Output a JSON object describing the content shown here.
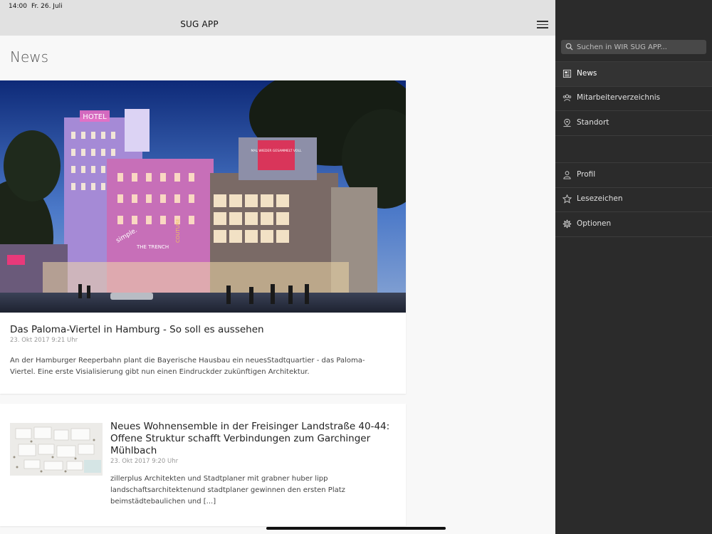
{
  "status": {
    "time": "14:00",
    "date": "Fr. 26. Juli"
  },
  "header": {
    "app_title": "SUG APP"
  },
  "page": {
    "title": "News"
  },
  "articles": [
    {
      "title": "Das Paloma-Viertel in Hamburg - So soll es aussehen",
      "date": "23. Okt 2017 9:21 Uhr",
      "excerpt": "An der Hamburger Reeperbahn plant die Bayerische Hausbau ein neuesStadtquartier - das Paloma-Viertel. Eine erste Visialisierung gibt nun einen Eindruckder zukünftigen Architektur."
    },
    {
      "title": "Neues Wohnensemble in der Freisinger Landstraße 40-44: Offene Struktur schafft Verbindungen zum Garchinger Mühlbach",
      "date": "23. Okt 2017 9:20 Uhr",
      "excerpt": "zillerplus Architekten und Stadtplaner mit grabner huber lipp landschaftsarchitektenund stadtplaner gewinnen den ersten Platz beimstädtebaulichen und [...]"
    }
  ],
  "image_text": {
    "hotel_sign": "HOTEL",
    "billboard": "MAL WIEDER GESAMMELT VOLL",
    "trench": "THE TRENCH",
    "simple": "simple.",
    "couture": "COUTURE"
  },
  "sidebar": {
    "search_placeholder": "Suchen in WIR SUG APP...",
    "items": [
      {
        "label": "News",
        "icon": "newspaper-icon",
        "active": true
      },
      {
        "label": "Mitarbeiterverzeichnis",
        "icon": "people-icon"
      },
      {
        "label": "Standort",
        "icon": "map-pin-icon"
      },
      {
        "label": "Profil",
        "icon": "person-icon"
      },
      {
        "label": "Lesezeichen",
        "icon": "star-icon"
      },
      {
        "label": "Optionen",
        "icon": "gear-icon"
      }
    ]
  },
  "colors": {
    "sidebar_bg": "#2b2b2b",
    "navbar_bg": "#e1e1e1",
    "content_bg": "#f8f8f8"
  }
}
